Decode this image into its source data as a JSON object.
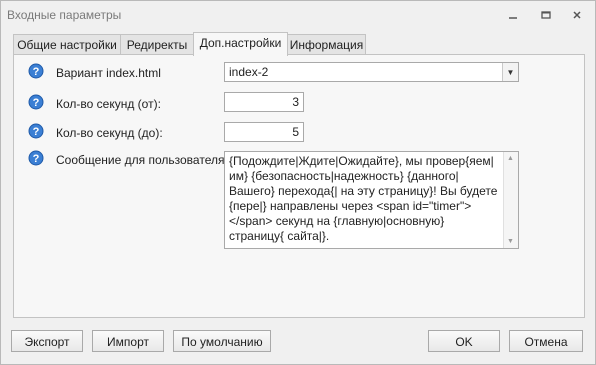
{
  "window": {
    "title": "Входные параметры"
  },
  "tabs": [
    {
      "label": "Общие настройки"
    },
    {
      "label": "Редиректы"
    },
    {
      "label": "Доп.настройки"
    },
    {
      "label": "Информация"
    }
  ],
  "fields": {
    "variant": {
      "label": "Вариант index.html",
      "value": "index-2"
    },
    "seconds_from": {
      "label": "Кол-во секунд (от):",
      "value": "3"
    },
    "seconds_to": {
      "label": "Кол-во секунд (до):",
      "value": "5"
    },
    "message": {
      "label": "Сообщение для пользователя:",
      "value": "{Подождите|Ждите|Ожидайте}, мы провер{яем|им} {безопасность|надежность} {данного|Вашего} перехода{| на эту страницу}! Вы будете {пере|} направлены через <span id=\"timer\"></span> секунд на {главную|основную} страницу{ сайта|}."
    }
  },
  "buttons": {
    "export": "Экспорт",
    "import": "Импорт",
    "default": "По умолчанию",
    "ok": "OK",
    "cancel": "Отмена"
  },
  "colors": {
    "help_icon": "#3b7fd4",
    "active_tab_bg": "#f7f7f7"
  },
  "icons": [
    "minimize-icon",
    "maximize-icon",
    "close-icon",
    "help-icon",
    "dropdown-arrow-icon"
  ]
}
